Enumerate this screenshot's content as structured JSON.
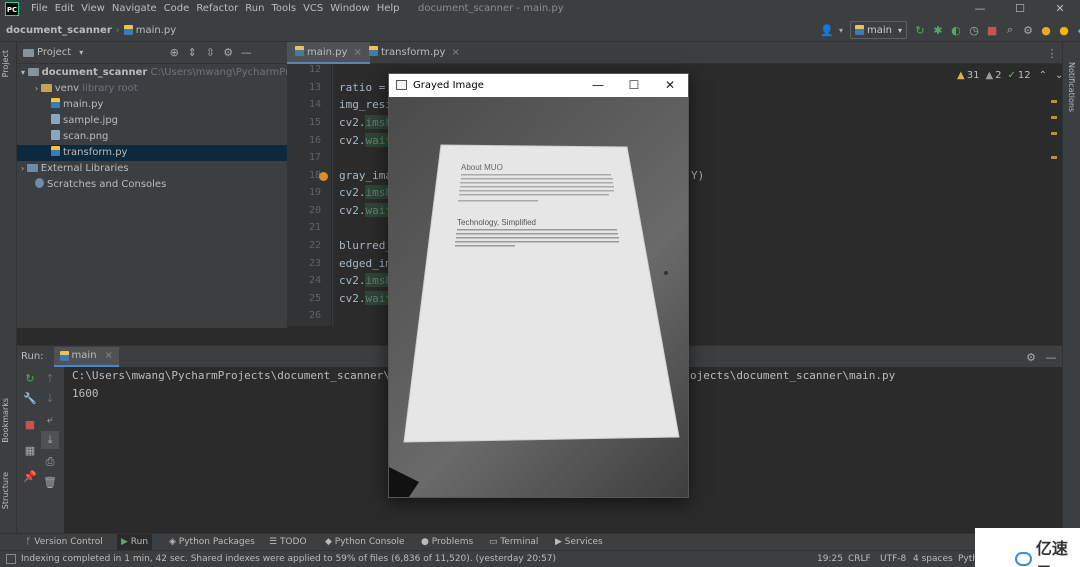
{
  "app": {
    "logo": "PC",
    "window_title": "document_scanner - main.py"
  },
  "menu": [
    "File",
    "Edit",
    "View",
    "Navigate",
    "Code",
    "Refactor",
    "Run",
    "Tools",
    "VCS",
    "Window",
    "Help"
  ],
  "window_controls": {
    "minimize": "—",
    "maximize": "☐",
    "close": "✕"
  },
  "breadcrumb": {
    "project": "document_scanner",
    "file": "main.py"
  },
  "toolbar": {
    "run_config": "main"
  },
  "project_panel": {
    "title": "Project",
    "tree": [
      {
        "label": "document_scanner",
        "hint": "C:\\Users\\mwang\\PycharmProjects"
      },
      {
        "label": "venv",
        "hint": "library root"
      },
      {
        "label": "main.py"
      },
      {
        "label": "sample.jpg"
      },
      {
        "label": "scan.png"
      },
      {
        "label": "transform.py"
      },
      {
        "label": "External Libraries"
      },
      {
        "label": "Scratches and Consoles"
      }
    ]
  },
  "editor": {
    "tabs": [
      {
        "label": "main.py"
      },
      {
        "label": "transform.py"
      }
    ],
    "inspections": {
      "warnings": "31",
      "weak": "2",
      "typos": "12"
    },
    "line_numbers": [
      "12",
      "13",
      "14",
      "15",
      "16",
      "17",
      "18",
      "19",
      "20",
      "21",
      "22",
      "23",
      "24",
      "25",
      "26"
    ],
    "lines": [
      "",
      "ratio =",
      "img_resi",
      "cv2.imsh",
      "cv2.wait",
      "",
      "gray_ima",
      "cv2.imsh",
      "cv2.wait",
      "",
      "blurred_",
      "edged_im",
      "cv2.imsh",
      "cv2.wait",
      ""
    ],
    "trailing": "Y)"
  },
  "run_panel": {
    "label": "Run:",
    "config": "main",
    "output_line1_left": "C:\\Users\\mwang\\PycharmProjects\\document_scanner\\ve",
    "output_line1_right": "ojects\\document_scanner\\main.py",
    "output_line2": "1600"
  },
  "side_tabs": {
    "project": "Project",
    "bookmarks": "Bookmarks",
    "structure": "Structure",
    "notifications": "Notifications"
  },
  "bottom_tabs": [
    "Version Control",
    "Run",
    "Python Packages",
    "TODO",
    "Python Console",
    "Problems",
    "Terminal",
    "Services"
  ],
  "status": {
    "message": "Indexing completed in 1 min, 42 sec. Shared indexes were applied to 59% of files (6,836 of 11,520). (yesterday 20:57)",
    "position": "19:25",
    "line_sep": "CRLF",
    "encoding": "UTF-8",
    "indent": "4 spaces",
    "interpreter": "Pytho"
  },
  "image_window": {
    "title": "Grayed Image",
    "doc_heading1": "About MUO",
    "doc_heading2": "Technology, Simplified"
  },
  "watermark": "亿速云"
}
